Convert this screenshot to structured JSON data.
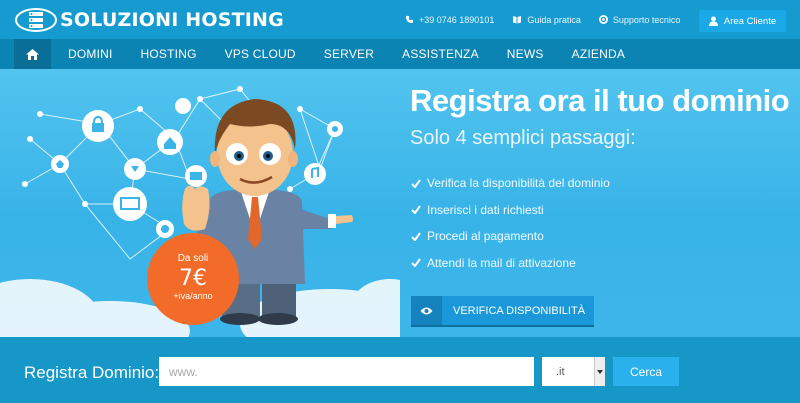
{
  "brand": {
    "name": "SOLUZIONI HOSTING"
  },
  "toplinks": [
    {
      "icon": "phone-icon",
      "label": "+39 0746 1890101"
    },
    {
      "icon": "book-icon",
      "label": "Guida pratica"
    },
    {
      "icon": "support-icon",
      "label": "Supporto tecnico"
    }
  ],
  "area_cliente": {
    "label": "Area Cliente",
    "icon": "user-icon"
  },
  "nav": {
    "home_icon": "home-icon",
    "items": [
      "DOMINI",
      "HOSTING",
      "VPS CLOUD",
      "SERVER",
      "ASSISTENZA",
      "NEWS",
      "AZIENDA"
    ]
  },
  "hero": {
    "title": "Registra ora il tuo dominio",
    "subtitle": "Solo 4 semplici passaggi:",
    "steps": [
      "Verifica la disponibilità del dominio",
      "Inserisci i dati richiesti",
      "Procedi al pagamento",
      "Attendi la mail di attivazione"
    ],
    "verify_button": "VERIFICA DISPONIBILITÀ",
    "promo": {
      "line1": "Da soli",
      "price": "7€",
      "line3": "+iva/anno"
    }
  },
  "search": {
    "label": "Registra Dominio:",
    "placeholder": "www.",
    "tld_value": ".it",
    "button": "Cerca"
  },
  "colors": {
    "primary": "#169bd0",
    "nav": "#0b84b3",
    "accent_orange": "#f36b28",
    "button": "#2ab1ec"
  }
}
